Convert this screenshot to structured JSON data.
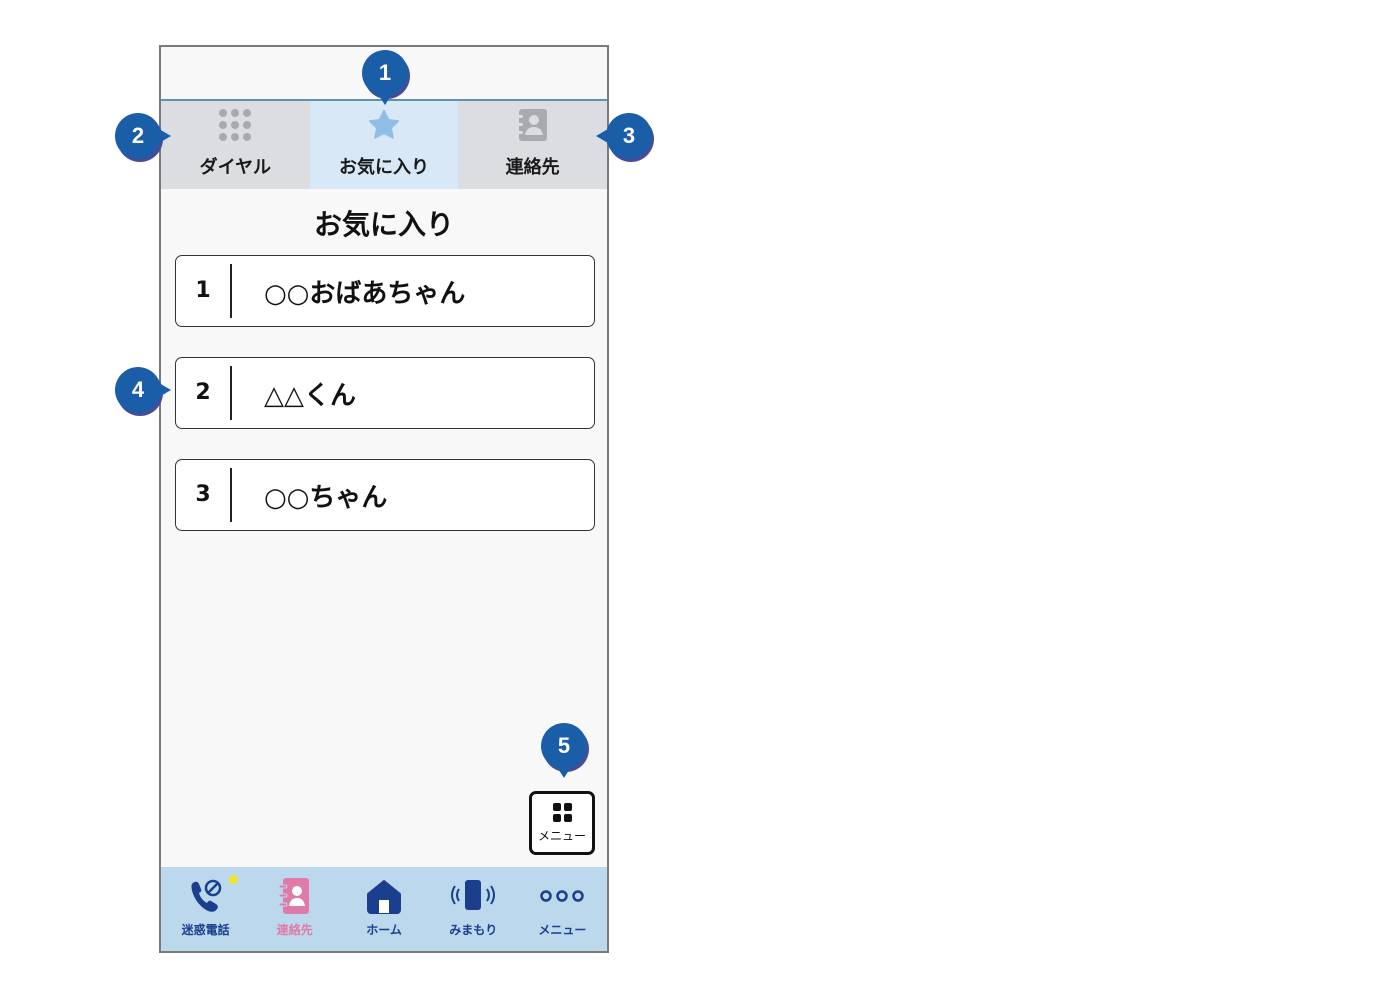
{
  "tabs": [
    {
      "label": "ダイヤル",
      "icon": "dialpad-icon"
    },
    {
      "label": "お気に入り",
      "icon": "star-icon",
      "active": true
    },
    {
      "label": "連絡先",
      "icon": "contacts-book-icon"
    }
  ],
  "page_title": "お気に入り",
  "favorites": [
    {
      "number": "1",
      "name": "○○おばあちゃん"
    },
    {
      "number": "2",
      "name": "△△くん"
    },
    {
      "number": "3",
      "name": "○○ちゃん"
    }
  ],
  "menu_button": {
    "label": "メニュー",
    "icon": "grid-icon"
  },
  "bottom_nav": [
    {
      "label": "迷惑電話",
      "icon": "blocked-call-icon"
    },
    {
      "label": "連絡先",
      "icon": "contacts-book-icon"
    },
    {
      "label": "ホーム",
      "icon": "home-icon"
    },
    {
      "label": "みまもり",
      "icon": "phone-vibrate-icon"
    },
    {
      "label": "メニュー",
      "icon": "more-dots-icon"
    }
  ],
  "callouts": [
    "1",
    "2",
    "3",
    "4",
    "5"
  ],
  "colors": {
    "badge": "#1a5ea8",
    "active_tab": "#d8e8f6",
    "nav_bg": "#bcd8ec",
    "nav_label": "#1b3f8c"
  }
}
